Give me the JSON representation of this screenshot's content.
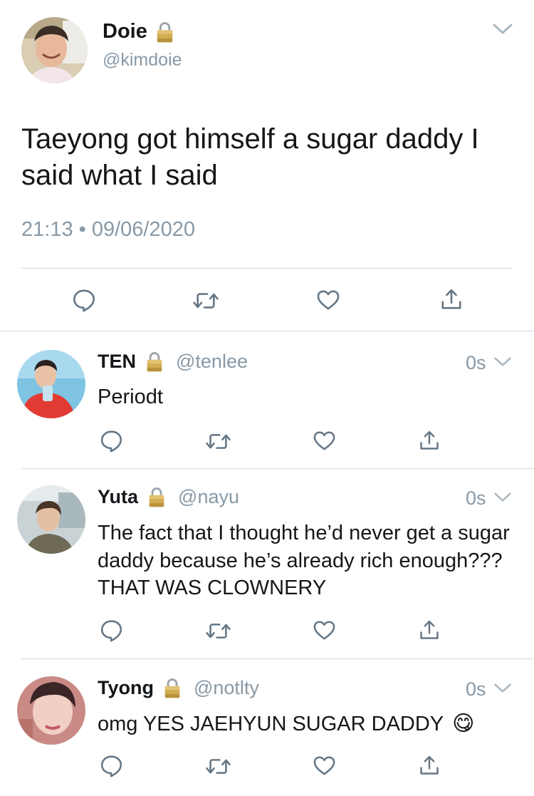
{
  "main_tweet": {
    "display_name": "Doie",
    "handle": "@kimdoie",
    "text": "Taeyong got himself a sugar daddy I said what I said",
    "timestamp": "21:13 • 09/06/2020"
  },
  "replies": [
    {
      "display_name": "TEN",
      "handle": "@tenlee",
      "time": "0s",
      "text": "Periodt"
    },
    {
      "display_name": "Yuta",
      "handle": "@nayu",
      "time": "0s",
      "text": "The fact that I thought he’d never get a sugar daddy because he’s already rich enough??? THAT WAS CLOWNERY"
    },
    {
      "display_name": "Tyong",
      "handle": "@notlty",
      "time": "0s",
      "text": "omg YES JAEHYUN SUGAR DADDY",
      "emoji": "😋"
    }
  ],
  "icons": {
    "reply": "reply-icon",
    "retweet": "retweet-icon",
    "like": "heart-icon",
    "share": "share-icon",
    "lock": "lock-icon",
    "menu": "chevron-down-icon"
  },
  "colors": {
    "text": "#14171a",
    "secondary": "#8899a6",
    "icon": "#657786",
    "lock_gold": "#c9a64b",
    "divider": "#d6d9dc"
  }
}
